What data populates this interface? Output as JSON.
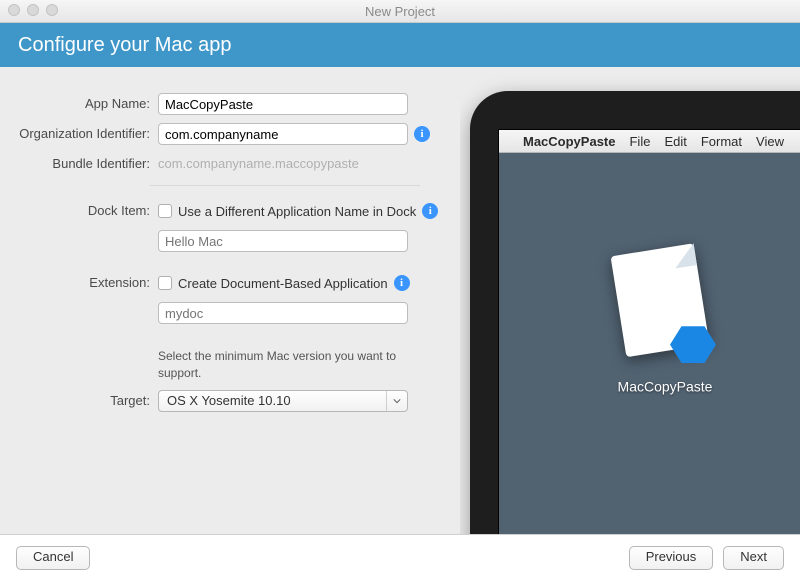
{
  "window": {
    "title": "New Project"
  },
  "banner": {
    "title": "Configure your Mac app"
  },
  "form": {
    "appName": {
      "label": "App Name:",
      "value": "MacCopyPaste"
    },
    "orgId": {
      "label": "Organization Identifier:",
      "value": "com.companyname"
    },
    "bundleId": {
      "label": "Bundle Identifier:",
      "value": "com.companyname.maccopypaste"
    },
    "dockItem": {
      "label": "Dock Item:",
      "checkboxLabel": "Use a Different Application Name in Dock",
      "placeholder": "Hello Mac"
    },
    "extension": {
      "label": "Extension:",
      "checkboxLabel": "Create Document-Based Application",
      "placeholder": "mydoc"
    },
    "targetHelp": "Select the minimum Mac version you want to support.",
    "target": {
      "label": "Target:",
      "value": "OS X Yosemite 10.10"
    }
  },
  "preview": {
    "menubar": {
      "appName": "MacCopyPaste",
      "items": [
        "File",
        "Edit",
        "Format",
        "View"
      ]
    },
    "appLabel": "MacCopyPaste"
  },
  "footer": {
    "cancel": "Cancel",
    "previous": "Previous",
    "next": "Next"
  }
}
